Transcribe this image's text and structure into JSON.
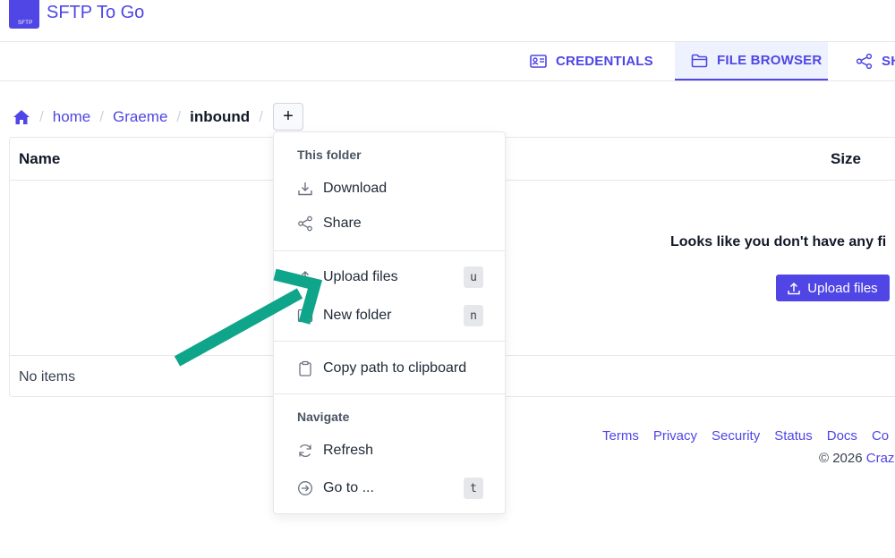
{
  "app": {
    "title": "SFTP To Go",
    "logo_text": "SFTP"
  },
  "tabs": [
    {
      "label": "CREDENTIALS",
      "icon": "id-card-icon",
      "active": false
    },
    {
      "label": "FILE BROWSER",
      "icon": "folder-icon",
      "active": true
    },
    {
      "label": "SH",
      "icon": "share-icon",
      "active": false
    }
  ],
  "breadcrumb": {
    "items": [
      "home",
      "Graeme"
    ],
    "current": "inbound",
    "add_label": "+"
  },
  "table": {
    "headers": {
      "name": "Name",
      "size": "Size"
    },
    "empty_message": "Looks like you don't have any fi",
    "upload_label": "Upload files",
    "footer_status": "No items"
  },
  "menu": {
    "section_this_folder": "This folder",
    "section_navigate": "Navigate",
    "items": {
      "download": "Download",
      "share": "Share",
      "upload": "Upload files",
      "upload_key": "u",
      "new_folder": "New folder",
      "new_folder_key": "n",
      "copy_path": "Copy path to clipboard",
      "refresh": "Refresh",
      "goto": "Go to ...",
      "goto_key": "t"
    }
  },
  "footer": {
    "links": [
      "Terms",
      "Privacy",
      "Security",
      "Status",
      "Docs",
      "Co"
    ],
    "copyright": "© 2026",
    "company": "Craz"
  },
  "colors": {
    "accent": "#4f46e5",
    "annotation": "#0fa58a"
  }
}
